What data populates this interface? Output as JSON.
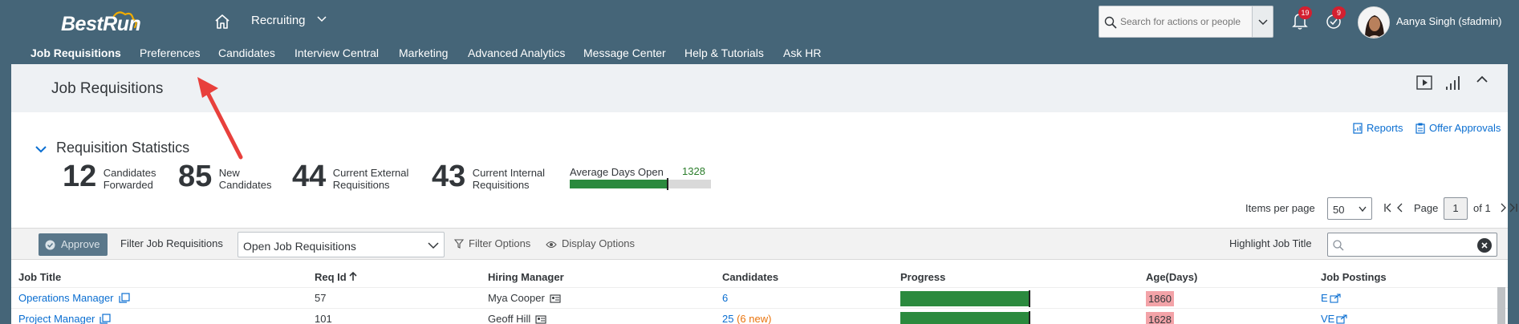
{
  "shell": {
    "logo_text": "BestRun",
    "module": "Recruiting",
    "search_placeholder": "Search for actions or people",
    "notifications_count": "19",
    "approvals_count": "9",
    "user_name": "Aanya Singh (sfadmin)"
  },
  "nav": {
    "items": [
      "Job Requisitions",
      "Preferences",
      "Candidates",
      "Interview Central",
      "Marketing",
      "Advanced Analytics",
      "Message Center",
      "Help & Tutorials",
      "Ask HR"
    ],
    "active": "Job Requisitions"
  },
  "page": {
    "title": "Job Requisitions"
  },
  "links": {
    "reports": "Reports",
    "offer_approvals": "Offer Approvals"
  },
  "stats": {
    "header": "Requisition Statistics",
    "items": [
      {
        "value": "12",
        "label_1": "Candidates",
        "label_2": "Forwarded"
      },
      {
        "value": "85",
        "label_1": "New",
        "label_2": "Candidates"
      },
      {
        "value": "44",
        "label_1": "Current External",
        "label_2": "Requisitions"
      },
      {
        "value": "43",
        "label_1": "Current Internal",
        "label_2": "Requisitions"
      }
    ],
    "avg_days_label": "Average Days Open",
    "avg_days_value": "1328",
    "avg_days_fill_fraction": 0.69
  },
  "pager": {
    "items_per_page_label": "Items per page",
    "items_per_page": "50",
    "page_label": "Page",
    "page": "1",
    "of_label": "of 1"
  },
  "toolbar": {
    "approve": "Approve",
    "filter_label": "Filter Job Requisitions",
    "filter_value": "Open Job Requisitions",
    "filter_options": "Filter Options",
    "display_options": "Display Options",
    "highlight_label": "Highlight Job Title"
  },
  "table": {
    "columns": [
      "Job Title",
      "Req Id",
      "Hiring Manager",
      "Candidates",
      "Progress",
      "Age(Days)",
      "Job Postings"
    ],
    "rows": [
      {
        "title": "Operations Manager",
        "req_id": "57",
        "manager": "Mya Cooper",
        "candidates": "6",
        "candidates_new": "",
        "age": "1860",
        "postings": "E",
        "progress": 1.0
      },
      {
        "title": "Project Manager",
        "req_id": "101",
        "manager": "Geoff Hill",
        "candidates": "25",
        "candidates_new": "(6 new)",
        "age": "1628",
        "postings": "VE",
        "progress": 1.0
      }
    ]
  },
  "colors": {
    "shell": "#456578",
    "link": "#0a6ed1",
    "progress": "#2b8a3e",
    "age_highlight": "#f3a3a8",
    "badge": "#d32030",
    "annotation_arrow": "#e8403c"
  }
}
